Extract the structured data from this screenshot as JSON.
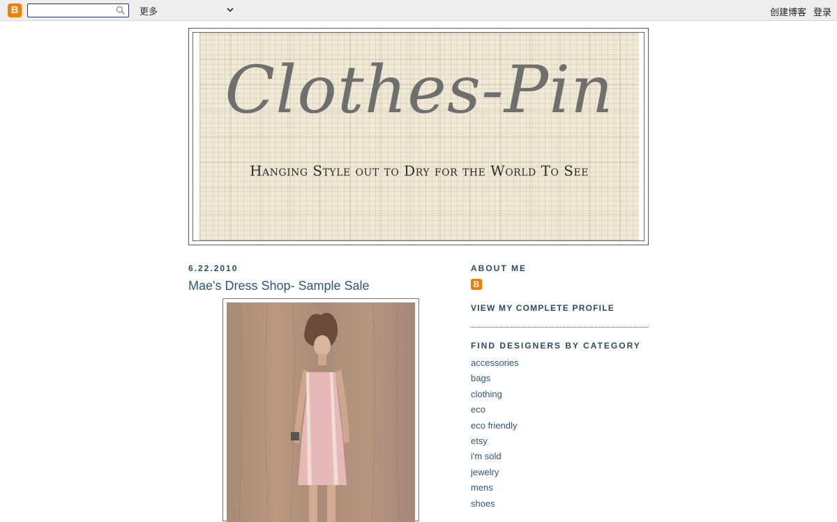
{
  "navbar": {
    "logo_letter": "B",
    "search_value": "",
    "more_label": "更多",
    "create_blog": "创建博客",
    "login": "登录",
    "icons": [
      "blogger-logo-icon",
      "search-icon",
      "chevron-down-icon"
    ]
  },
  "header": {
    "title": "Clothes-Pin",
    "tagline": "Hanging Style out to Dry for the World To See"
  },
  "post": {
    "date": "6.22.2010",
    "title": "Mae's Dress Shop- Sample Sale"
  },
  "sidebar": {
    "about_heading": "ABOUT ME",
    "profile_icon_letter": "B",
    "view_profile": "VIEW MY COMPLETE PROFILE",
    "categories_heading": "FIND DESIGNERS BY CATEGORY",
    "categories": [
      "accessories",
      "bags",
      "clothing",
      "eco",
      "eco friendly",
      "etsy",
      "i'm sold",
      "jewelry",
      "mens",
      "shoes"
    ]
  },
  "colors": {
    "link": "#2d5777",
    "heading": "#2b4a5c",
    "blogger_orange": "#f57d00",
    "navbar_bg": "#eeeeee"
  }
}
